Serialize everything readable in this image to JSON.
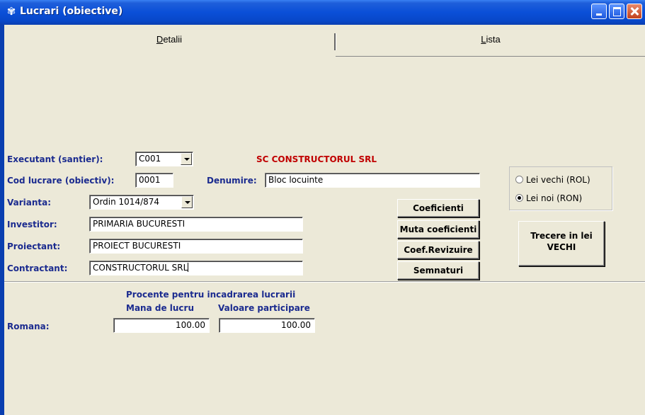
{
  "window": {
    "title": "Lucrari (obiective)",
    "icon": "app-icon"
  },
  "tabs": [
    {
      "label": "Detalii",
      "underline": "D",
      "rest": "etalii",
      "active": true
    },
    {
      "label": "Lista",
      "underline": "L",
      "rest": "ista",
      "active": false
    }
  ],
  "form": {
    "executant": {
      "label": "Executant (santier):",
      "value": "C001",
      "company": "SC CONSTRUCTORUL SRL"
    },
    "cod": {
      "label": "Cod lucrare (obiectiv):",
      "value": "0001"
    },
    "denumire": {
      "label": "Denumire:",
      "value": "Bloc locuinte"
    },
    "varianta": {
      "label": "Varianta:",
      "value": "Ordin 1014/874"
    },
    "investitor": {
      "label": "Investitor:",
      "value": "PRIMARIA BUCURESTI"
    },
    "proiectant": {
      "label": "Proiectant:",
      "value": "PROIECT BUCURESTI"
    },
    "contractant": {
      "label": "Contractant:",
      "value": "CONSTRUCTORUL SRL"
    }
  },
  "buttons": {
    "coeficienti": "Coeficienti",
    "muta": "Muta coeficienti",
    "revizuire": "Coef.Revizuire",
    "semnaturi": "Semnaturi",
    "trecere_line1": "Trecere in lei",
    "trecere_line2": "VECHI"
  },
  "currency": {
    "options": [
      "Lei vechi (ROL)",
      "Lei noi (RON)"
    ],
    "selected": "Lei noi (RON)"
  },
  "procente": {
    "heading": "Procente pentru incadrarea lucrarii",
    "col1": "Mana de lucru",
    "col2": "Valoare participare",
    "row_label": "Romana:",
    "mana": "100.00",
    "valoare": "100.00"
  }
}
